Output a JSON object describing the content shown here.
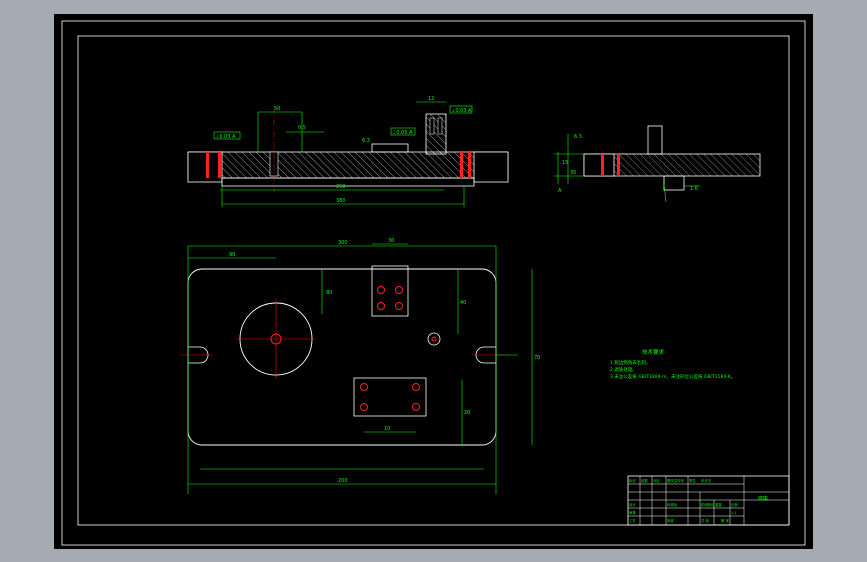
{
  "colors": {
    "frame": "#ffffff",
    "geometry": "#ffffff",
    "dimension": "#00ff00",
    "section_hatch": "#ffffff",
    "hole_red": "#ff2020",
    "center_red": "#ff0000",
    "text_green": "#00ff00",
    "page_bg": "#a6aab2",
    "canvas_bg": "#000000"
  },
  "front_view": {
    "callouts": [
      "⊥0.03 A",
      "0.5",
      "⊥0.05 A",
      "⊥0.03 A"
    ],
    "dimensions": [
      "380",
      "250",
      "12",
      "50",
      "6.3"
    ]
  },
  "side_view": {
    "dimensions": [
      "6.3",
      "15",
      "35",
      "A",
      "1.6"
    ]
  },
  "plan_view": {
    "dimensions": [
      "300",
      "90",
      "80",
      "30",
      "40",
      "70",
      "20",
      "10",
      "200"
    ]
  },
  "notes": {
    "title": "技术要求",
    "lines": [
      "1.锐边倒角去毛刺。",
      "2.调质处理。",
      "3.未注公差按 GB/T1804-m，未注形位公差按 GB/T1184-K。"
    ]
  },
  "title_block": {
    "part_name": "底座",
    "cells": [
      "标记",
      "处数",
      "分区",
      "更改文件号",
      "签名",
      "年月日",
      "设计",
      "标准化",
      "审核",
      "工艺",
      "批准",
      "阶段标记",
      "重量",
      "比例",
      "1:1",
      "共 张",
      "第 张"
    ]
  }
}
